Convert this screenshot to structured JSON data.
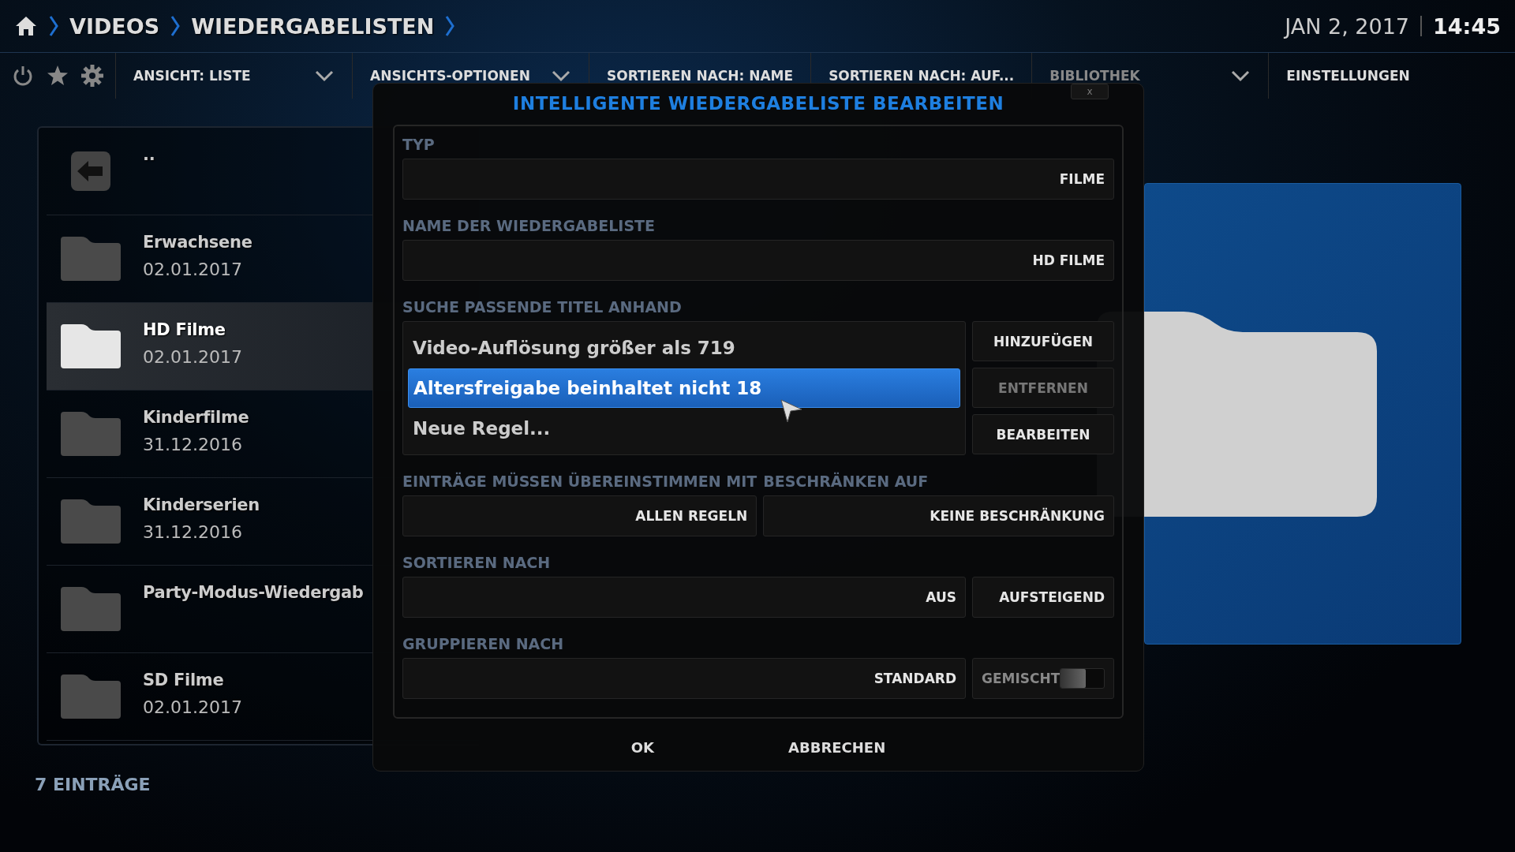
{
  "breadcrumb": [
    "VIDEOS",
    "WIEDERGABELISTEN"
  ],
  "clock": {
    "date": "JAN 2, 2017",
    "time": "14:45"
  },
  "toolbar": {
    "menus": [
      {
        "label": "ANSICHT: LISTE",
        "dropdown": true
      },
      {
        "label": "ANSICHTS-OPTIONEN",
        "dropdown": true
      },
      {
        "label": "SORTIEREN NACH: NAME",
        "dropdown": false
      },
      {
        "label": "SORTIEREN NACH: AUF...",
        "dropdown": false
      },
      {
        "label": "BIBLIOTHEK",
        "dropdown": true
      },
      {
        "label": "EINSTELLUNGEN",
        "dropdown": false
      }
    ]
  },
  "list": {
    "items": [
      {
        "kind": "back",
        "title": "..",
        "selected": false
      },
      {
        "kind": "folder",
        "title": "Erwachsene",
        "date": "02.01.2017",
        "selected": false
      },
      {
        "kind": "folder",
        "title": "HD Filme",
        "date": "02.01.2017",
        "selected": true
      },
      {
        "kind": "folder",
        "title": "Kinderfilme",
        "date": "31.12.2016",
        "selected": false
      },
      {
        "kind": "folder",
        "title": "Kinderserien",
        "date": "31.12.2016",
        "selected": false
      },
      {
        "kind": "folder",
        "title": "Party-Modus-Wiedergab",
        "selected": false
      },
      {
        "kind": "folder",
        "title": "SD Filme",
        "date": "02.01.2017",
        "selected": false
      }
    ],
    "count": "7 EINTRÄGE"
  },
  "preview": {
    "kind": "folder"
  },
  "dialog": {
    "title": "INTELLIGENTE WIEDERGABELISTE BEARBEITEN",
    "close": "x",
    "type": {
      "label": "TYP",
      "value": "FILME"
    },
    "name": {
      "label": "NAME DER WIEDERGABELISTE",
      "value": "HD FILME"
    },
    "rules": {
      "label": "SUCHE PASSENDE TITEL ANHAND",
      "items": [
        {
          "text": "Video-Auflösung größer als 719",
          "selected": false
        },
        {
          "text": "Altersfreigabe beinhaltet nicht 18",
          "selected": true
        },
        {
          "text": "Neue Regel...",
          "selected": false
        }
      ],
      "buttons": [
        {
          "label": "HINZUFÜGEN",
          "disabled": false
        },
        {
          "label": "ENTFERNEN",
          "disabled": true
        },
        {
          "label": "BEARBEITEN",
          "disabled": false
        }
      ]
    },
    "match": {
      "label": "EINTRÄGE MÜSSEN ÜBEREINSTIMMEN MIT",
      "value": "ALLEN REGELN"
    },
    "limit": {
      "label": "BESCHRÄNKEN AUF",
      "value": "KEINE BESCHRÄNKUNG"
    },
    "sort": {
      "label": "SORTIEREN NACH",
      "value": "AUS",
      "order": "AUFSTEIGEND"
    },
    "group": {
      "label": "GRUPPIEREN NACH",
      "value": "STANDARD",
      "mixed": {
        "label": "GEMISCHT",
        "on": false
      }
    },
    "actions": [
      "OK",
      "ABBRECHEN"
    ]
  }
}
